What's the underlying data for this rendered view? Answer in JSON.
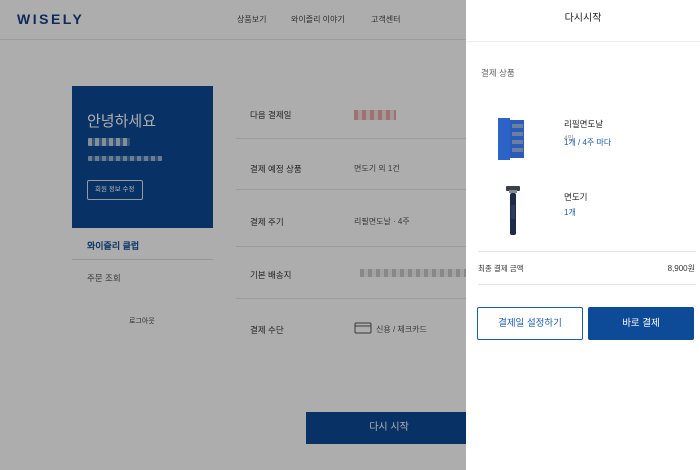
{
  "header": {
    "logo": "WISELY",
    "nav": [
      "상품보기",
      "와이즐리 이야기",
      "고객센터"
    ]
  },
  "profile": {
    "greeting": "안녕하세요",
    "edit_label": "회원 정보 수정"
  },
  "sidebar": {
    "club_label": "와이즐리 클럽",
    "order_label": "주문 조회",
    "logout_label": "로그아웃"
  },
  "subscription": {
    "rows": [
      {
        "label": "다음 결제일",
        "value": ""
      },
      {
        "label": "결제 예정 상품",
        "value": "면도기 외 1건"
      },
      {
        "label": "결제 주기",
        "value": "리필면도날 · 4주"
      },
      {
        "label": "기본 배송지",
        "value": ""
      },
      {
        "label": "결제 수단",
        "value": "신용 / 체크카드"
      }
    ],
    "restart_label": "다시 시작"
  },
  "drawer": {
    "title": "다시시작",
    "section_title": "결제 상품",
    "products": [
      {
        "name": "리필면도날",
        "detail": "4입",
        "info": "1개 / 4주 마다",
        "icon": "razor-blade-refill-icon"
      },
      {
        "name": "면도기",
        "detail": "",
        "info": "1개",
        "icon": "razor-icon"
      }
    ],
    "total_label": "최종 결제 금액",
    "total_amount": "8,900원",
    "set_date_label": "결제일 설정하기",
    "pay_now_label": "바로 결제"
  },
  "colors": {
    "brand": "#0d4a97",
    "link": "#1e5dad",
    "overlay": "rgba(0,0,0,0.32)"
  }
}
